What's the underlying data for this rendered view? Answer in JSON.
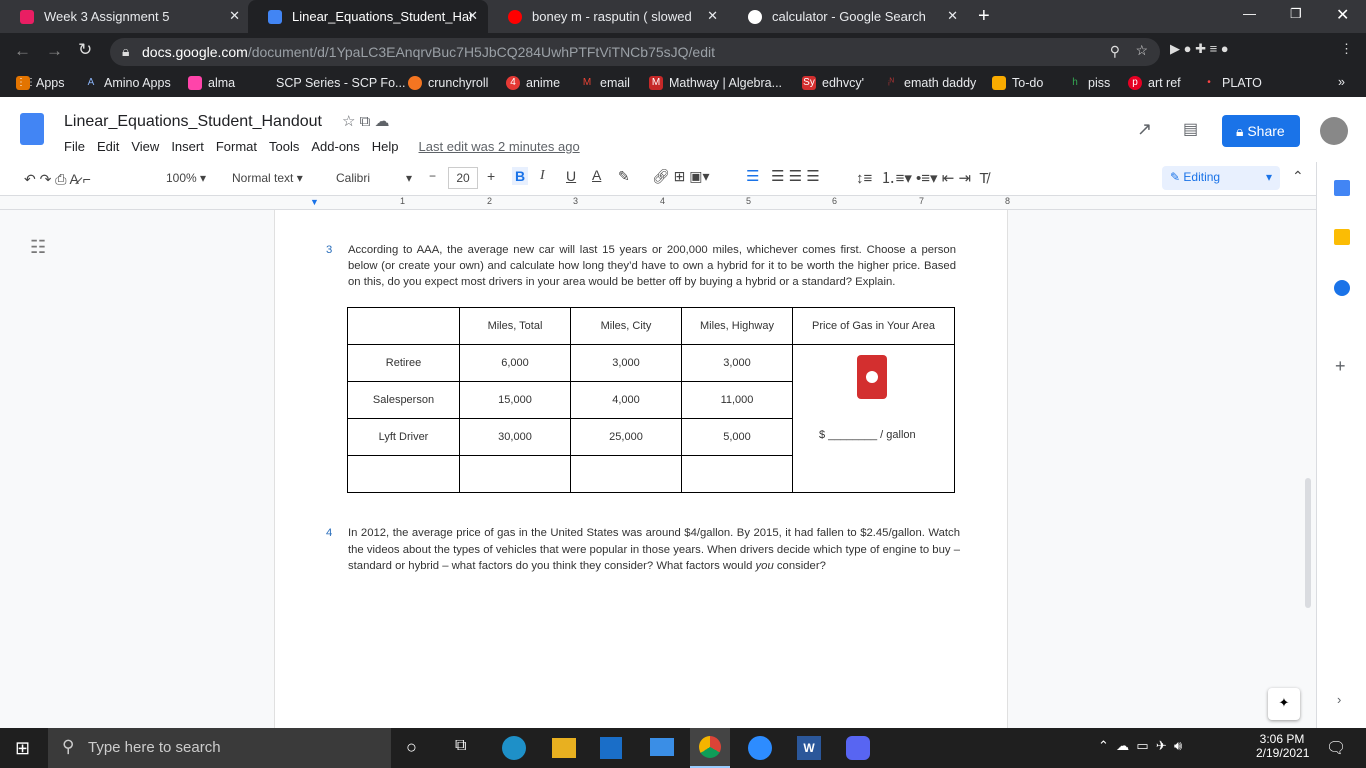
{
  "browser": {
    "tabs": [
      {
        "title": "Week 3 Assignment 5",
        "color": "#e91e63"
      },
      {
        "title": "Linear_Equations_Student_Handout",
        "color": "#4285f4"
      },
      {
        "title": "boney m - rasputin ( slowed",
        "color": "#ff0000"
      },
      {
        "title": "calculator - Google Search",
        "color": "#ffffff"
      }
    ],
    "url_host": "docs.google.com",
    "url_path": "/document/d/1YpaLC3EAnqrvBuc7H5JbCQ284UwhPTFtViTNCb75sJQ/edit",
    "bookmarks": [
      "Apps",
      "Amino Apps",
      "alma",
      "SCP Series - SCP Fo...",
      "crunchyroll",
      "anime",
      "email",
      "Mathway | Algebra...",
      "edhvcy'",
      "emath daddy",
      "To-do",
      "piss",
      "art ref",
      "PLATO"
    ]
  },
  "docs": {
    "title": "Linear_Equations_Student_Handout",
    "menu": [
      "File",
      "Edit",
      "View",
      "Insert",
      "Format",
      "Tools",
      "Add-ons",
      "Help"
    ],
    "last_edit": "Last edit was 2 minutes ago",
    "share": "Share",
    "toolbar": {
      "zoom": "100%",
      "style": "Normal text",
      "font": "Calibri",
      "size": "20",
      "mode": "Editing"
    },
    "ruler": [
      "1",
      "2",
      "3",
      "4",
      "5",
      "6",
      "7",
      "8"
    ]
  },
  "document": {
    "q3_num": "3",
    "q3": "According to AAA, the average new car will last 15 years or 200,000 miles, whichever comes first. Choose a person below (or create your own) and calculate how long they’d have to own a hybrid for it to be worth the higher price. Based on this, do you expect most drivers in your area would be better off by buying a hybrid or a standard? Explain.",
    "table": {
      "headers": [
        "",
        "Miles, Total",
        "Miles, City",
        "Miles, Highway",
        "Price of Gas in Your Area"
      ],
      "rows": [
        [
          "Retiree",
          "6,000",
          "3,000",
          "3,000"
        ],
        [
          "Salesperson",
          "15,000",
          "4,000",
          "11,000"
        ],
        [
          "Lyft Driver",
          "30,000",
          "25,000",
          "5,000"
        ],
        [
          "",
          "",
          "",
          ""
        ]
      ],
      "gas_price": "$ ________ / gallon"
    },
    "q4_num": "4",
    "q4_a": "In 2012, the average price of gas in the United States was around $4/gallon. By 2015, it had fallen to $2.45/gallon. Watch the videos about the types of vehicles that were popular in those years. When drivers decide which type of engine to buy – standard or hybrid – what factors do you think they consider? What factors would ",
    "q4_em": "you",
    "q4_b": " consider?"
  },
  "taskbar": {
    "search": "Type here to search",
    "time": "3:06 PM",
    "date": "2/19/2021"
  }
}
